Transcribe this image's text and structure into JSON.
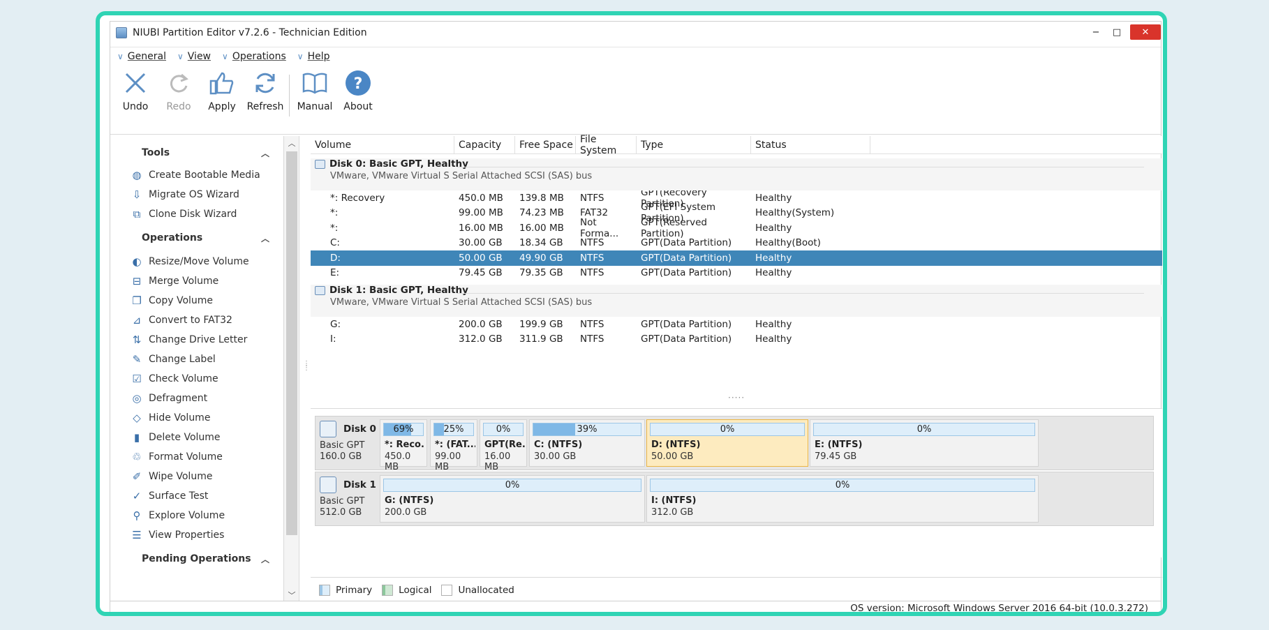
{
  "window": {
    "title": "NIUBI Partition Editor v7.2.6 - Technician Edition",
    "min": "−",
    "max": "□",
    "close": "✕"
  },
  "menu": [
    "General",
    "View",
    "Operations",
    "Help"
  ],
  "toolbar": [
    {
      "label": "Undo",
      "icon": "x-icon",
      "disabled": false
    },
    {
      "label": "Redo",
      "icon": "redo-icon",
      "disabled": true
    },
    {
      "label": "Apply",
      "icon": "thumbs-up-icon",
      "disabled": false
    },
    {
      "label": "Refresh",
      "icon": "refresh-icon",
      "disabled": false
    },
    {
      "label": "Manual",
      "icon": "book-icon",
      "disabled": false
    },
    {
      "label": "About",
      "icon": "question-icon",
      "disabled": false
    }
  ],
  "sidebar": {
    "tools_title": "Tools",
    "tools": [
      {
        "label": "Create Bootable Media",
        "icon": "globe-icon",
        "glyph": "◍"
      },
      {
        "label": "Migrate OS Wizard",
        "icon": "migrate-icon",
        "glyph": "⇩"
      },
      {
        "label": "Clone Disk Wizard",
        "icon": "clone-icon",
        "glyph": "⧉"
      }
    ],
    "operations_title": "Operations",
    "operations": [
      {
        "label": "Resize/Move Volume",
        "icon": "resize-icon",
        "glyph": "◐"
      },
      {
        "label": "Merge Volume",
        "icon": "merge-icon",
        "glyph": "⊟"
      },
      {
        "label": "Copy Volume",
        "icon": "copy-icon",
        "glyph": "❐"
      },
      {
        "label": "Convert to FAT32",
        "icon": "convert-icon",
        "glyph": "⊿"
      },
      {
        "label": "Change Drive Letter",
        "icon": "drive-letter-icon",
        "glyph": "⇅"
      },
      {
        "label": "Change Label",
        "icon": "edit-icon",
        "glyph": "✎"
      },
      {
        "label": "Check Volume",
        "icon": "check-icon",
        "glyph": "☑"
      },
      {
        "label": "Defragment",
        "icon": "defragment-icon",
        "glyph": "◎"
      },
      {
        "label": "Hide Volume",
        "icon": "hide-icon",
        "glyph": "◇"
      },
      {
        "label": "Delete Volume",
        "icon": "delete-icon",
        "glyph": "▮"
      },
      {
        "label": "Format Volume",
        "icon": "format-icon",
        "glyph": "♲"
      },
      {
        "label": "Wipe Volume",
        "icon": "wipe-icon",
        "glyph": "✐"
      },
      {
        "label": "Surface Test",
        "icon": "surface-test-icon",
        "glyph": "✓"
      },
      {
        "label": "Explore Volume",
        "icon": "search-icon",
        "glyph": "⚲"
      },
      {
        "label": "View Properties",
        "icon": "properties-icon",
        "glyph": "☰"
      }
    ],
    "pending_title": "Pending Operations"
  },
  "table": {
    "columns": [
      "Volume",
      "Capacity",
      "Free Space",
      "File System",
      "Type",
      "Status"
    ],
    "disks": [
      {
        "title": "Disk 0: Basic GPT, Healthy",
        "subtitle": "VMware, VMware Virtual S Serial Attached SCSI (SAS) bus",
        "rows": [
          [
            "*: Recovery",
            "450.0 MB",
            "139.8 MB",
            "NTFS",
            "GPT(Recovery Partition)",
            "Healthy"
          ],
          [
            "*:",
            "99.00 MB",
            "74.23 MB",
            "FAT32",
            "GPT(EFI System Partition)",
            "Healthy(System)"
          ],
          [
            "*:",
            "16.00 MB",
            "16.00 MB",
            "Not Forma...",
            "GPT(Reserved Partition)",
            "Healthy"
          ],
          [
            "C:",
            "30.00 GB",
            "18.34 GB",
            "NTFS",
            "GPT(Data Partition)",
            "Healthy(Boot)"
          ],
          [
            "D:",
            "50.00 GB",
            "49.90 GB",
            "NTFS",
            "GPT(Data Partition)",
            "Healthy"
          ],
          [
            "E:",
            "79.45 GB",
            "79.35 GB",
            "NTFS",
            "GPT(Data Partition)",
            "Healthy"
          ]
        ]
      },
      {
        "title": "Disk 1: Basic GPT, Healthy",
        "subtitle": "VMware, VMware Virtual S Serial Attached SCSI (SAS) bus",
        "rows": [
          [
            "G:",
            "200.0 GB",
            "199.9 GB",
            "NTFS",
            "GPT(Data Partition)",
            "Healthy"
          ],
          [
            "I:",
            "312.0 GB",
            "311.9 GB",
            "NTFS",
            "GPT(Data Partition)",
            "Healthy"
          ]
        ]
      }
    ],
    "selected_row": "D:"
  },
  "diskmap": [
    {
      "name": "Disk 0",
      "type": "Basic GPT",
      "size": "160.0 GB",
      "partitions": [
        {
          "pct_label": "69%",
          "used": 0.69,
          "name": "*: Reco...",
          "size": "450.0 MB",
          "selected": false
        },
        {
          "pct_label": "25%",
          "used": 0.25,
          "name": "*: (FAT...",
          "size": "99.00 MB",
          "selected": false
        },
        {
          "pct_label": "0%",
          "used": 0.0,
          "name": "GPT(Re...",
          "size": "16.00 MB",
          "selected": false
        },
        {
          "pct_label": "39%",
          "used": 0.39,
          "name": "C: (NTFS)",
          "size": "30.00 GB",
          "selected": false
        },
        {
          "pct_label": "0%",
          "used": 0.0,
          "name": "D: (NTFS)",
          "size": "50.00 GB",
          "selected": true
        },
        {
          "pct_label": "0%",
          "used": 0.0,
          "name": "E: (NTFS)",
          "size": "79.45 GB",
          "selected": false
        }
      ]
    },
    {
      "name": "Disk 1",
      "type": "Basic GPT",
      "size": "512.0 GB",
      "partitions": [
        {
          "pct_label": "0%",
          "used": 0.0,
          "name": "G: (NTFS)",
          "size": "200.0 GB",
          "selected": false
        },
        {
          "pct_label": "0%",
          "used": 0.0,
          "name": "I: (NTFS)",
          "size": "312.0 GB",
          "selected": false
        }
      ]
    }
  ],
  "legend": [
    "Primary",
    "Logical",
    "Unallocated"
  ],
  "colors": {
    "accent": "#2fd4b4",
    "selection": "#3f86b8",
    "primary": "#deeefa",
    "logical": "#cfe8d4",
    "unallocated": "#ffffff",
    "close": "#d9342b"
  },
  "status": "OS version: Microsoft Windows Server 2016  64-bit  (10.0.3.272)"
}
